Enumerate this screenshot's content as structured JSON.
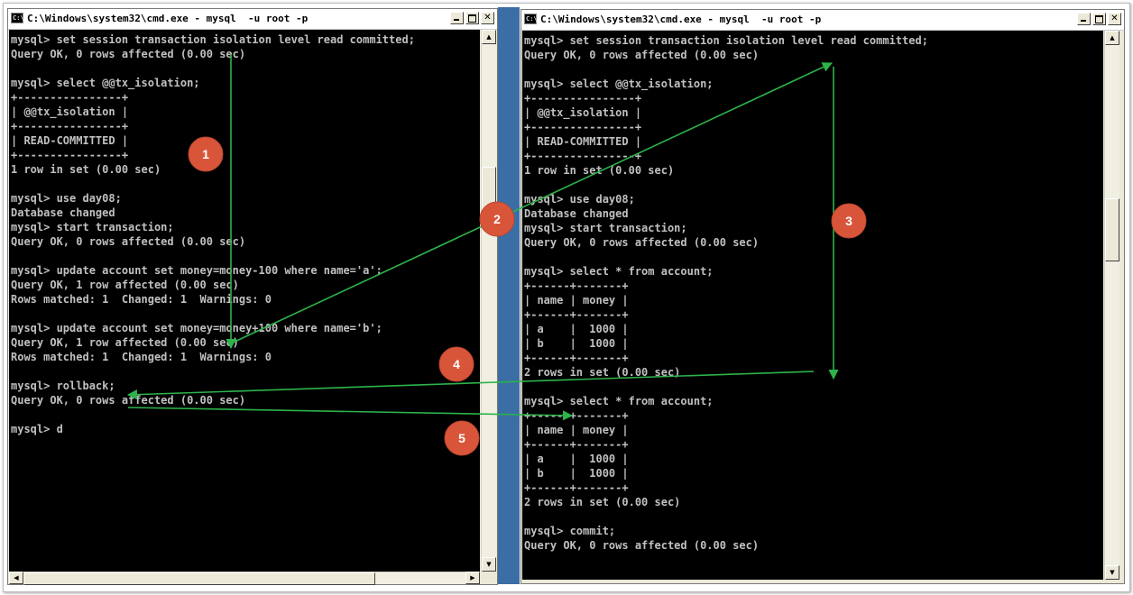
{
  "colors": {
    "console_bg": "#000000",
    "console_text": "#c0c0c0",
    "arrow": "#2db34a",
    "badge": "#d9553a",
    "divider": "#3b6ea5"
  },
  "left_window": {
    "title": "C:\\Windows\\system32\\cmd.exe - mysql  -u root -p",
    "icon": "cmd-icon",
    "lines": [
      "mysql> set session transaction isolation level read committed;",
      "Query OK, 0 rows affected (0.00 sec)",
      "",
      "mysql> select @@tx_isolation;",
      "+----------------+",
      "| @@tx_isolation |",
      "+----------------+",
      "| READ-COMMITTED |",
      "+----------------+",
      "1 row in set (0.00 sec)",
      "",
      "mysql> use day08;",
      "Database changed",
      "mysql> start transaction;",
      "Query OK, 0 rows affected (0.00 sec)",
      "",
      "mysql> update account set money=money-100 where name='a';",
      "Query OK, 1 row affected (0.00 sec)",
      "Rows matched: 1  Changed: 1  Warnings: 0",
      "",
      "mysql> update account set money=money+100 where name='b';",
      "Query OK, 1 row affected (0.00 sec)",
      "Rows matched: 1  Changed: 1  Warnings: 0",
      "",
      "mysql> rollback;",
      "Query OK, 0 rows affected (0.00 sec)",
      "",
      "mysql> d"
    ]
  },
  "right_window": {
    "title": "C:\\Windows\\system32\\cmd.exe - mysql  -u root -p",
    "icon": "cmd-icon",
    "lines": [
      "mysql> set session transaction isolation level read committed;",
      "Query OK, 0 rows affected (0.00 sec)",
      "",
      "mysql> select @@tx_isolation;",
      "+----------------+",
      "| @@tx_isolation |",
      "+----------------+",
      "| READ-COMMITTED |",
      "+----------------+",
      "1 row in set (0.00 sec)",
      "",
      "mysql> use day08;",
      "Database changed",
      "mysql> start transaction;",
      "Query OK, 0 rows affected (0.00 sec)",
      "",
      "mysql> select * from account;",
      "+------+-------+",
      "| name | money |",
      "+------+-------+",
      "| a    |  1000 |",
      "| b    |  1000 |",
      "+------+-------+",
      "2 rows in set (0.00 sec)",
      "",
      "mysql> select * from account;",
      "+------+-------+",
      "| name | money |",
      "+------+-------+",
      "| a    |  1000 |",
      "| b    |  1000 |",
      "+------+-------+",
      "2 rows in set (0.00 sec)",
      "",
      "mysql> commit;",
      "Query OK, 0 rows affected (0.00 sec)"
    ]
  },
  "annotations": {
    "steps": [
      "1",
      "2",
      "3",
      "4",
      "5"
    ]
  }
}
